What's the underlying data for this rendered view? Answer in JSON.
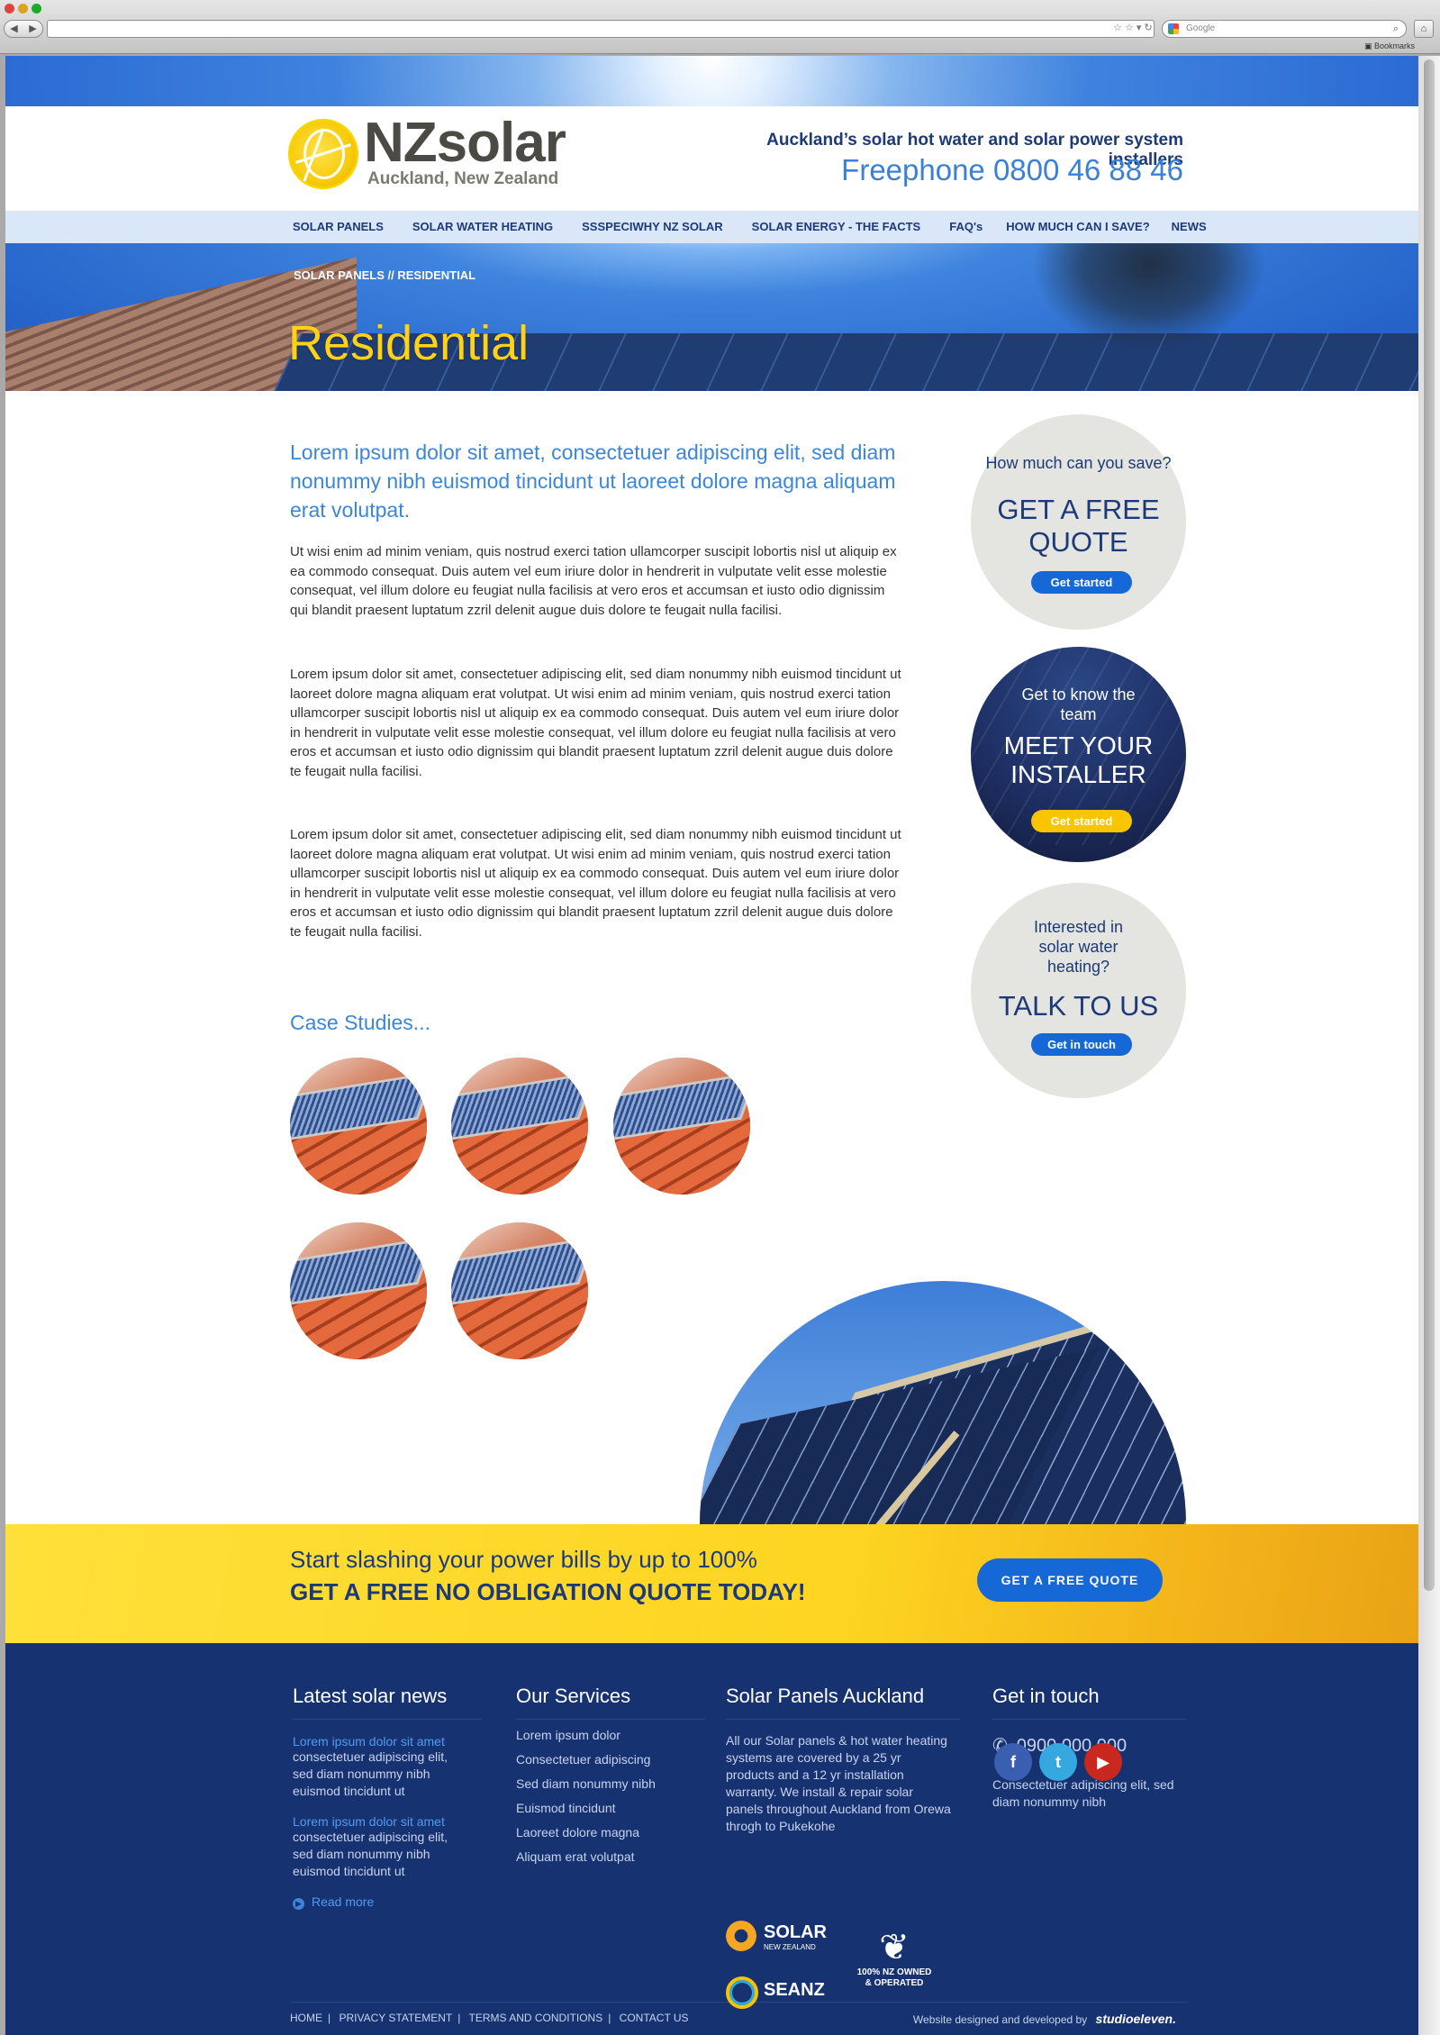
{
  "browser": {
    "search_placeholder": "Google",
    "bookmarks_label": "Bookmarks"
  },
  "header": {
    "logo_name": "NZsolar",
    "logo_sub": "Auckland, New Zealand",
    "tagline": "Auckland’s solar hot water and solar power system installers",
    "phone": "Freephone 0800 46 88 46"
  },
  "nav": {
    "items": [
      "SOLAR PANELS",
      "SOLAR WATER HEATING",
      "SSSPECIWHY NZ SOLAR",
      "SOLAR ENERGY - THE FACTS",
      "FAQ's",
      "HOW MUCH CAN I SAVE?",
      "NEWS"
    ]
  },
  "hero": {
    "crumb_1": "SOLAR PANELS",
    "crumb_sep": "//",
    "crumb_2": "RESIDENTIAL",
    "title": "Residential"
  },
  "content": {
    "intro": "Lorem ipsum dolor sit amet, consectetuer adipiscing elit, sed diam nonummy nibh euismod tincidunt ut laoreet dolore magna aliquam erat volutpat.",
    "para1": "Ut wisi enim ad minim veniam, quis nostrud exerci tation ullamcorper suscipit lobortis nisl ut aliquip ex ea commodo consequat. Duis autem vel eum iriure dolor in hendrerit in vulputate velit esse molestie consequat, vel illum dolore eu feugiat nulla facilisis at vero eros et accumsan et iusto odio dignissim qui blandit praesent luptatum zzril delenit augue duis dolore te feugait nulla facilisi.",
    "para2": "Lorem ipsum dolor sit amet, consectetuer adipiscing elit, sed diam nonummy nibh euismod tincidunt ut laoreet dolore magna aliquam erat volutpat. Ut wisi enim ad minim veniam, quis nostrud exerci tation ullamcorper suscipit lobortis nisl ut aliquip ex ea commodo consequat. Duis autem vel eum iriure dolor in hendrerit in vulputate velit esse molestie consequat, vel illum dolore eu feugiat nulla facilisis at vero eros et accumsan et iusto odio dignissim qui blandit praesent luptatum zzril delenit augue duis dolore te feugait nulla facilisi.",
    "para3": "Lorem ipsum dolor sit amet, consectetuer adipiscing elit, sed diam nonummy nibh euismod tincidunt ut laoreet dolore magna aliquam erat volutpat. Ut wisi enim ad minim veniam, quis nostrud exerci tation ullamcorper suscipit lobortis nisl ut aliquip ex ea commodo consequat. Duis autem vel eum iriure dolor in hendrerit in vulputate velit esse molestie consequat, vel illum dolore eu feugiat nulla facilisis at vero eros et accumsan et iusto odio dignissim qui blandit praesent luptatum zzril delenit augue duis dolore te feugait nulla facilisi.",
    "case_title": "Case Studies..."
  },
  "sidebar": {
    "quote": {
      "q": "How much can you save?",
      "big": "GET A FREE QUOTE",
      "btn": "Get started"
    },
    "installer": {
      "q": "Get to know the team",
      "big": "MEET YOUR INSTALLER",
      "btn": "Get started"
    },
    "talk": {
      "q": "Interested in solar water heating?",
      "big": "TALK TO US",
      "btn": "Get in touch"
    }
  },
  "cta": {
    "line1": "Start slashing your power bills by up to 100%",
    "line2": "GET A FREE NO OBLIGATION QUOTE TODAY!",
    "button": "GET A FREE QUOTE"
  },
  "footer": {
    "news_title": "Latest solar news",
    "news": [
      {
        "link": "Lorem ipsum dolor sit amet",
        "text": "consectetuer adipiscing elit, sed diam nonummy nibh euismod tincidunt ut"
      },
      {
        "link": "Lorem ipsum dolor sit amet",
        "text": "consectetuer adipiscing elit, sed diam nonummy nibh euismod tincidunt ut"
      }
    ],
    "read_more": "Read more",
    "services_title": "Our Services",
    "services": [
      "Lorem ipsum dolor",
      "Consectetuer adipiscing",
      "Sed diam nonummy nibh",
      "Euismod tincidunt",
      "Laoreet dolore magna",
      "Aliquam erat volutpat"
    ],
    "panels_title": "Solar Panels Auckland",
    "panels_text": "All our Solar panels & hot water heating systems are covered by a 25 yr products and a 12 yr installation warranty. We install & repair solar panels throughout Auckland from Orewa throgh to Pukekohe",
    "badge_solar": "SOLAR",
    "badge_solar_sub": "NEW ZEALAND",
    "badge_seanz": "SEANZ",
    "badge_nz": "100% NZ OWNED & OPERATED",
    "contact_title": "Get in touch",
    "contact_phone": "0900 000 000",
    "contact_text": "Consectetuer adipiscing elit, sed diam nonummy nibh",
    "links": [
      "HOME",
      "PRIVACY STATEMENT",
      "TERMS AND CONDITIONS",
      "CONTACT US"
    ],
    "credit": "Website designed and developed by",
    "credit_brand": "studioeleven."
  },
  "colors": {
    "brand_blue": "#173270",
    "accent_blue": "#3b86d8",
    "yellow": "#ffd21a",
    "button_blue": "#1668d6"
  }
}
